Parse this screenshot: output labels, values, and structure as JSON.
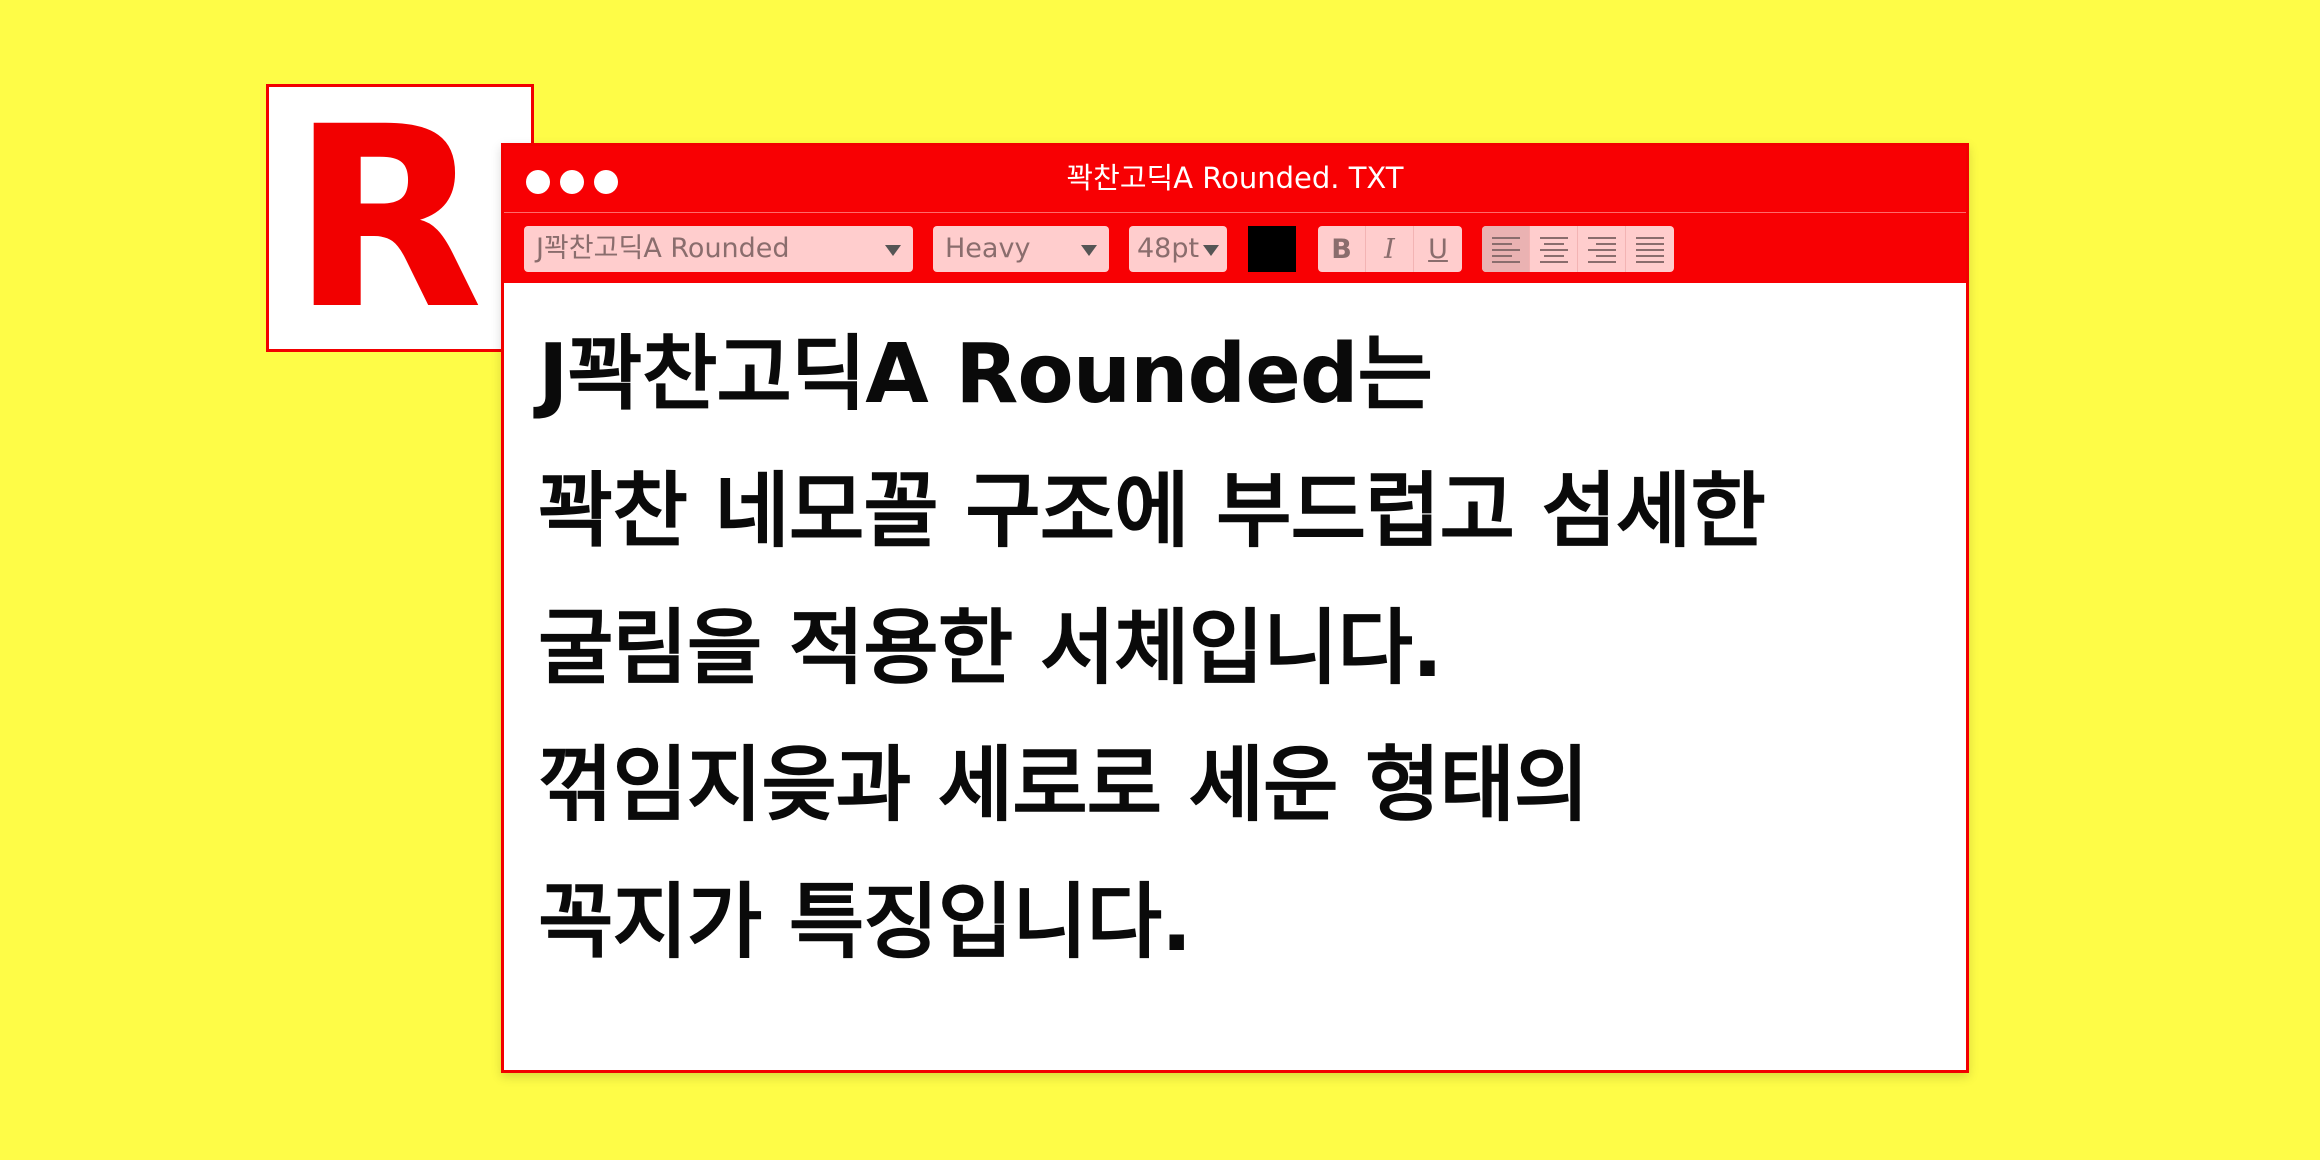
{
  "logo": {
    "letter": "R"
  },
  "window": {
    "title": "꽉찬고딕A Rounded. TXT",
    "traffic_lights": [
      "close-dot",
      "minimize-dot",
      "maximize-dot"
    ]
  },
  "toolbar": {
    "font_family": "J꽉찬고딕A Rounded",
    "font_weight": "Heavy",
    "font_size": "48pt",
    "text_color": "#000000",
    "format_buttons": {
      "bold": "B",
      "italic": "I",
      "underline": "U"
    },
    "alignment": {
      "selected": "left",
      "options": [
        "left",
        "center",
        "right",
        "justify"
      ]
    }
  },
  "document": {
    "lines": [
      "J꽉찬고딕A Rounded는",
      "꽉찬 네모꼴 구조에 부드럽고 섬세한",
      "굴림을 적용한 서체입니다.",
      "꺾임지읒과 세로로 세운 형태의",
      "꼭지가 특징입니다."
    ]
  },
  "colors": {
    "background": "#fefc47",
    "accent": "#f80003",
    "control_fill": "#ffcdcd"
  }
}
